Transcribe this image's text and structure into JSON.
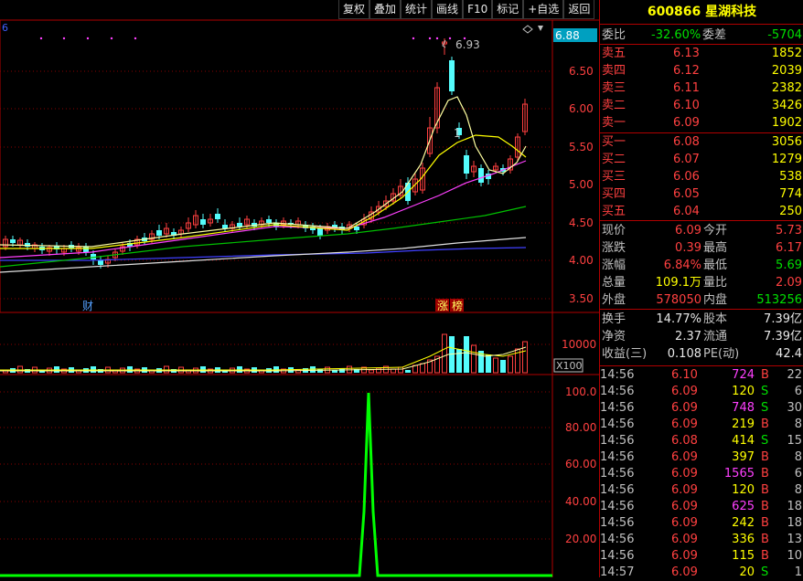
{
  "toolbar": {
    "items": [
      "复权",
      "叠加",
      "统计",
      "画线",
      "F10",
      "标记",
      "+自选",
      "返回"
    ]
  },
  "stock": {
    "code": "600866",
    "name": "星湖科技"
  },
  "chart": {
    "last_price_tag": "6.88",
    "high_label": "6.93",
    "price_axis": [
      "6.50",
      "6.00",
      "5.50",
      "5.00",
      "4.50",
      "4.00",
      "3.50"
    ],
    "volume_axis": [
      "10000"
    ],
    "volume_unit": "X100",
    "indicator_axis": [
      "100.0",
      "80.00",
      "60.00",
      "40.00",
      "20.00"
    ],
    "marker_cai": "财",
    "marker_zhang": "涨",
    "marker_bang": "榜",
    "marker_1": "1",
    "marker_6": "6"
  },
  "quote": {
    "weibi_label": "委比",
    "weibi": "-32.60%",
    "weicha_label": "委差",
    "weicha": "-5704",
    "asks": [
      {
        "label": "卖五",
        "price": "6.13",
        "vol": "1852"
      },
      {
        "label": "卖四",
        "price": "6.12",
        "vol": "2039"
      },
      {
        "label": "卖三",
        "price": "6.11",
        "vol": "2382"
      },
      {
        "label": "卖二",
        "price": "6.10",
        "vol": "3426"
      },
      {
        "label": "卖一",
        "price": "6.09",
        "vol": "1902"
      }
    ],
    "bids": [
      {
        "label": "买一",
        "price": "6.08",
        "vol": "3056"
      },
      {
        "label": "买二",
        "price": "6.07",
        "vol": "1279"
      },
      {
        "label": "买三",
        "price": "6.06",
        "vol": "538"
      },
      {
        "label": "买四",
        "price": "6.05",
        "vol": "774"
      },
      {
        "label": "买五",
        "price": "6.04",
        "vol": "250"
      }
    ],
    "stats": [
      {
        "l1": "现价",
        "v1": "6.09",
        "l2": "今开",
        "v2": "5.73"
      },
      {
        "l1": "涨跌",
        "v1": "0.39",
        "l2": "最高",
        "v2": "6.17"
      },
      {
        "l1": "涨幅",
        "v1": "6.84%",
        "l2": "最低",
        "v2": "5.69"
      },
      {
        "l1": "总量",
        "v1": "109.1万",
        "l2": "量比",
        "v2": "2.09"
      },
      {
        "l1": "外盘",
        "v1": "578050",
        "l2": "内盘",
        "v2": "513256"
      }
    ],
    "fund": [
      {
        "l1": "换手",
        "v1": "14.77%",
        "l2": "股本",
        "v2": "7.39亿"
      },
      {
        "l1": "净资",
        "v1": "2.37",
        "l2": "流通",
        "v2": "7.39亿"
      },
      {
        "l1": "收益(三)",
        "v1": "0.108",
        "l2": "PE(动)",
        "v2": "42.4"
      }
    ]
  },
  "ticks": [
    {
      "time": "14:56",
      "price": "6.10",
      "vol": "724",
      "bs": "B",
      "n": "22"
    },
    {
      "time": "14:56",
      "price": "6.09",
      "vol": "120",
      "bs": "S",
      "n": "6"
    },
    {
      "time": "14:56",
      "price": "6.09",
      "vol": "748",
      "bs": "S",
      "n": "30"
    },
    {
      "time": "14:56",
      "price": "6.09",
      "vol": "219",
      "bs": "B",
      "n": "8"
    },
    {
      "time": "14:56",
      "price": "6.08",
      "vol": "414",
      "bs": "S",
      "n": "15"
    },
    {
      "time": "14:56",
      "price": "6.09",
      "vol": "397",
      "bs": "B",
      "n": "8"
    },
    {
      "time": "14:56",
      "price": "6.09",
      "vol": "1565",
      "bs": "B",
      "n": "6"
    },
    {
      "time": "14:56",
      "price": "6.09",
      "vol": "120",
      "bs": "B",
      "n": "8"
    },
    {
      "time": "14:56",
      "price": "6.09",
      "vol": "625",
      "bs": "B",
      "n": "18"
    },
    {
      "time": "14:56",
      "price": "6.09",
      "vol": "242",
      "bs": "B",
      "n": "18"
    },
    {
      "time": "14:56",
      "price": "6.09",
      "vol": "336",
      "bs": "B",
      "n": "13"
    },
    {
      "time": "14:56",
      "price": "6.09",
      "vol": "115",
      "bs": "B",
      "n": "10"
    },
    {
      "time": "14:57",
      "price": "6.09",
      "vol": "20",
      "bs": "S",
      "n": "1"
    }
  ],
  "colors": {
    "up": "#ff4040",
    "down": "#54fcfc",
    "ma5": "#ffffa0",
    "ma10": "#ffff00",
    "ma20": "#ff40ff",
    "ma30": "#00c000",
    "ma60": "#e0e0e0",
    "ma120": "#4040ff",
    "indicator": "#00ff00",
    "frame": "#b00000"
  }
}
